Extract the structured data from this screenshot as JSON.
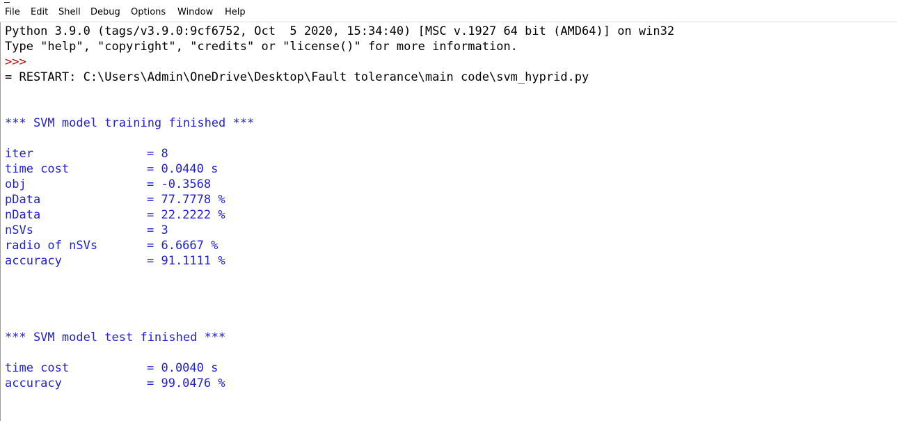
{
  "menu": [
    "File",
    "Edit",
    "Shell",
    "Debug",
    "Options",
    "Window",
    "Help"
  ],
  "shell": {
    "banner_line1": "Python 3.9.0 (tags/v3.9.0:9cf6752, Oct  5 2020, 15:34:40) [MSC v.1927 64 bit (AMD64)] on win32",
    "banner_line2": "Type \"help\", \"copyright\", \"credits\" or \"license()\" for more information.",
    "prompt": ">>>",
    "restart_line": "= RESTART: C:\\Users\\Admin\\OneDrive\\Desktop\\Fault tolerance\\main code\\svm_hyprid.py",
    "training_header": "*** SVM model training finished ***",
    "training_stats": [
      {
        "key": "iter",
        "value": "= 8"
      },
      {
        "key": "time cost",
        "value": "= 0.0440 s"
      },
      {
        "key": "obj",
        "value": "= -0.3568"
      },
      {
        "key": "pData",
        "value": "= 77.7778 %"
      },
      {
        "key": "nData",
        "value": "= 22.2222 %"
      },
      {
        "key": "nSVs",
        "value": "= 3"
      },
      {
        "key": "radio of nSVs",
        "value": "= 6.6667 %"
      },
      {
        "key": "accuracy",
        "value": "= 91.1111 %"
      }
    ],
    "test_header": "*** SVM model test finished ***",
    "test_stats": [
      {
        "key": "time cost",
        "value": "= 0.0040 s"
      },
      {
        "key": "accuracy",
        "value": "= 99.0476 %"
      }
    ]
  },
  "colors": {
    "output_text": "#1f1fd6",
    "prompt": "#b30000",
    "normal_text": "#000000"
  }
}
